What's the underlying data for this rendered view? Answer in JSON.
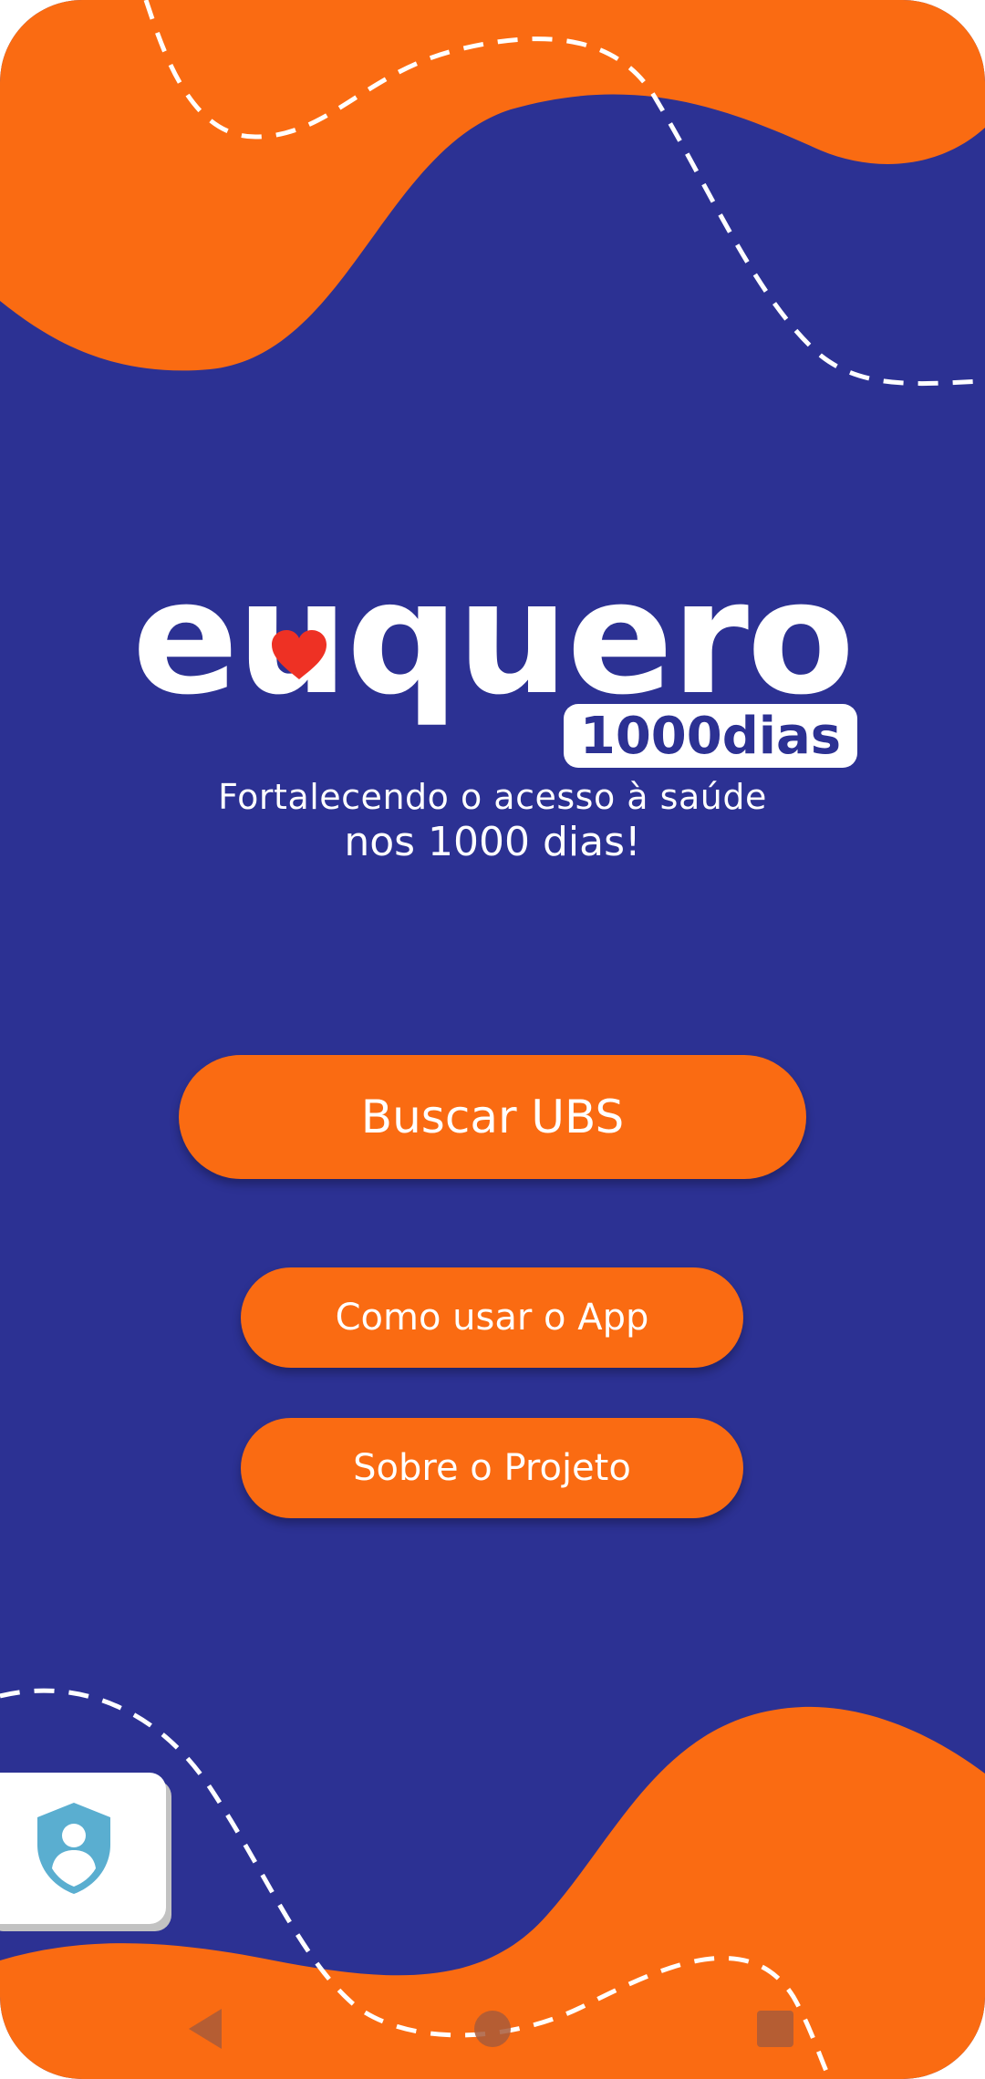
{
  "app": {
    "logo_word": "euquero",
    "logo_badge": "1000dias"
  },
  "tagline": {
    "line1": "Fortalecendo o acesso à saúde",
    "line2": "nos 1000 dias!"
  },
  "buttons": {
    "search_ubs": "Buscar UBS",
    "how_to_use": "Como usar o App",
    "about_project": "Sobre o Projeto"
  },
  "icons": {
    "privacy": "shield-user-icon",
    "heart": "heart-icon",
    "back": "nav-back-icon",
    "home": "nav-home-icon",
    "recents": "nav-recents-icon"
  },
  "colors": {
    "background": "#2c3193",
    "accent": "#fa6b12",
    "heart": "#ee3124",
    "text": "#ffffff",
    "privacy_icon": "#5aaed0"
  }
}
